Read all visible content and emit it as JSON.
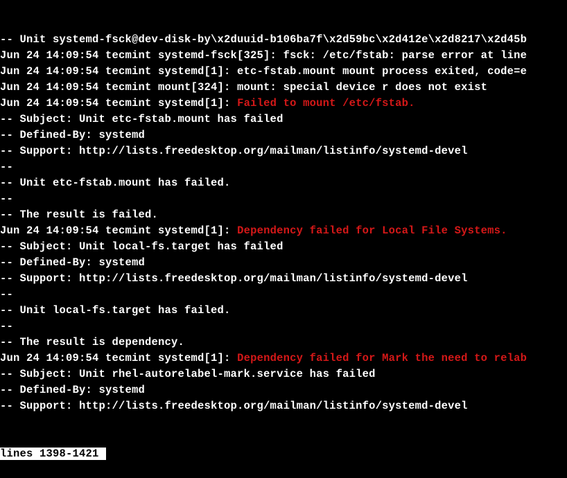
{
  "lines": [
    {
      "type": "plain",
      "text": "-- Unit systemd-fsck@dev-disk-by\\x2duuid-b106ba7f\\x2d59bc\\x2d412e\\x2d8217\\x2d45b"
    },
    {
      "type": "plain",
      "text": "Jun 24 14:09:54 tecmint systemd-fsck[325]: fsck: /etc/fstab: parse error at line"
    },
    {
      "type": "plain",
      "text": "Jun 24 14:09:54 tecmint systemd[1]: etc-fstab.mount mount process exited, code=e"
    },
    {
      "type": "plain",
      "text": "Jun 24 14:09:54 tecmint mount[324]: mount: special device r does not exist"
    },
    {
      "type": "mixed",
      "prefix": "Jun 24 14:09:54 tecmint systemd[1]: ",
      "error": "Failed to mount /etc/fstab."
    },
    {
      "type": "plain",
      "text": "-- Subject: Unit etc-fstab.mount has failed"
    },
    {
      "type": "plain",
      "text": "-- Defined-By: systemd"
    },
    {
      "type": "plain",
      "text": "-- Support: http://lists.freedesktop.org/mailman/listinfo/systemd-devel"
    },
    {
      "type": "plain",
      "text": "--"
    },
    {
      "type": "plain",
      "text": "-- Unit etc-fstab.mount has failed."
    },
    {
      "type": "plain",
      "text": "--"
    },
    {
      "type": "plain",
      "text": "-- The result is failed."
    },
    {
      "type": "mixed",
      "prefix": "Jun 24 14:09:54 tecmint systemd[1]: ",
      "error": "Dependency failed for Local File Systems."
    },
    {
      "type": "plain",
      "text": "-- Subject: Unit local-fs.target has failed"
    },
    {
      "type": "plain",
      "text": "-- Defined-By: systemd"
    },
    {
      "type": "plain",
      "text": "-- Support: http://lists.freedesktop.org/mailman/listinfo/systemd-devel"
    },
    {
      "type": "plain",
      "text": "--"
    },
    {
      "type": "plain",
      "text": "-- Unit local-fs.target has failed."
    },
    {
      "type": "plain",
      "text": "--"
    },
    {
      "type": "plain",
      "text": "-- The result is dependency."
    },
    {
      "type": "mixed",
      "prefix": "Jun 24 14:09:54 tecmint systemd[1]: ",
      "error": "Dependency failed for Mark the need to relab"
    },
    {
      "type": "plain",
      "text": "-- Subject: Unit rhel-autorelabel-mark.service has failed"
    },
    {
      "type": "plain",
      "text": "-- Defined-By: systemd"
    },
    {
      "type": "plain",
      "text": "-- Support: http://lists.freedesktop.org/mailman/listinfo/systemd-devel"
    }
  ],
  "status": "lines 1398-1421"
}
